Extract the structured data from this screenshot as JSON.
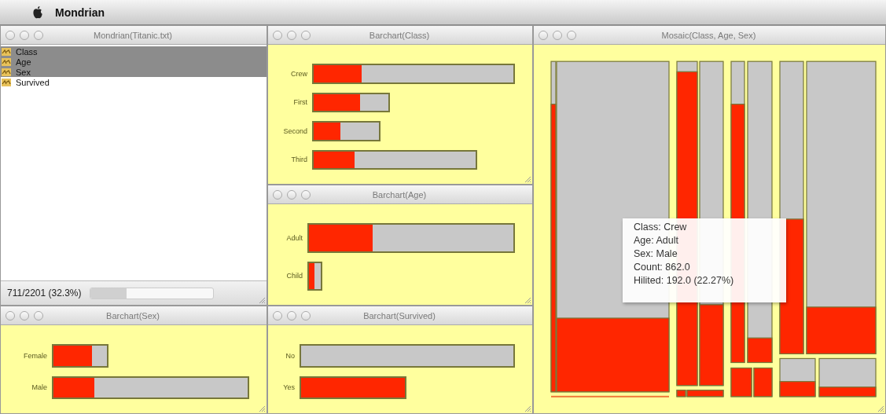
{
  "menu_bar": {
    "app_name": "Mondrian"
  },
  "variables_window": {
    "title": "Mondrian(Titanic.txt)",
    "variables": [
      {
        "name": "Class",
        "selected": true
      },
      {
        "name": "Age",
        "selected": true
      },
      {
        "name": "Sex",
        "selected": true
      },
      {
        "name": "Survived",
        "selected": false
      }
    ],
    "status": "711/2201 (32.3%)",
    "progress": {
      "level": 0.3
    }
  },
  "barcharts": [
    {
      "title": "Barchart(Class)",
      "bars": [
        {
          "label": "Crew",
          "hilite": {
            "level": 0.24
          }
        },
        {
          "label": "First",
          "hilite": {
            "level": 0.62
          }
        },
        {
          "label": "Second",
          "hilite": {
            "level": 0.41
          }
        },
        {
          "label": "Third",
          "hilite": {
            "level": 0.25
          }
        }
      ]
    },
    {
      "title": "Barchart(Age)",
      "bars": [
        {
          "label": "Adult",
          "hilite": {
            "level": 0.31
          }
        },
        {
          "label": "Child"
        }
      ]
    },
    {
      "title": "Barchart(Sex)",
      "bars": [
        {
          "label": "Female",
          "hilite": {
            "level": 0.73
          }
        },
        {
          "label": "Male",
          "hilite": {
            "level": 0.21
          }
        }
      ]
    },
    {
      "title": "Barchart(Survived)",
      "bars": [
        {
          "label": "No",
          "highlighted": false
        },
        {
          "label": "Yes",
          "highlighted": true
        }
      ]
    }
  ],
  "mosaic_window": {
    "title": "Mosaic(Class, Age, Sex)",
    "tooltip": [
      "Class: Crew",
      "Age: Adult",
      "Sex: Male",
      "Count: 862.0",
      "Hilited: 192.0 (22.27%)"
    ]
  }
}
